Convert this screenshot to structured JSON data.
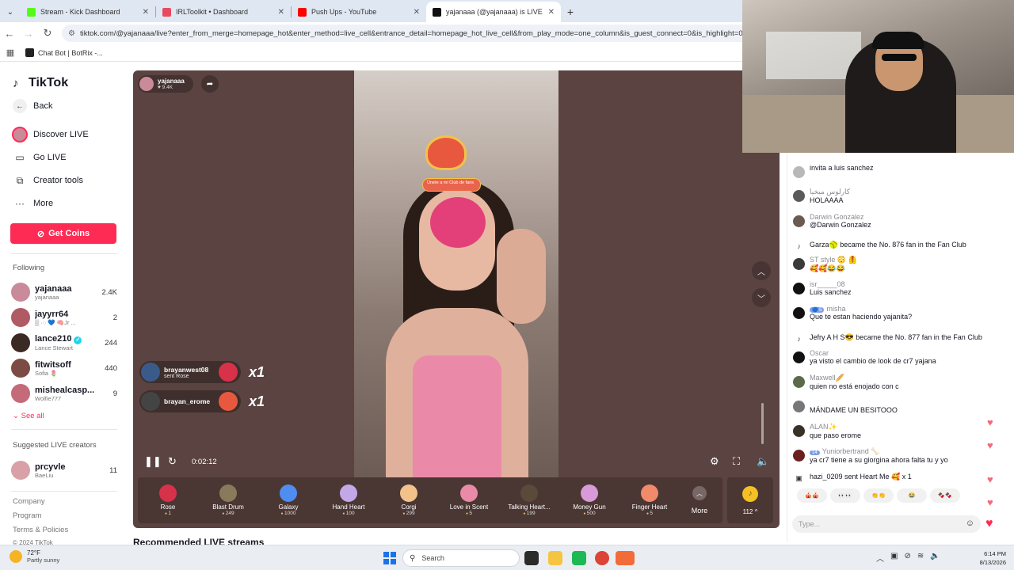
{
  "browser": {
    "tabs": [
      {
        "label": "Stream - Kick Dashboard",
        "favicon_color": "#53fc18",
        "active": false
      },
      {
        "label": "IRLToolkit • Dashboard",
        "favicon_color": "#e84a5f",
        "active": false
      },
      {
        "label": "Push Ups - YouTube",
        "favicon_color": "#ff0000",
        "active": false
      },
      {
        "label": "yajanaaa (@yajanaaa) is LIVE",
        "favicon_color": "#111111",
        "active": true
      }
    ],
    "url": "tiktok.com/@yajanaaa/live?enter_from_merge=homepage_hot&enter_method=live_cell&entrance_detail=homepage_hot_live_cell&from_play_mode=one_column&is_guest_connect=0&is_highlight=0&s",
    "bookmark": "Chat Bot | BotRix -..."
  },
  "sidebar": {
    "logo": "TikTok",
    "nav": [
      {
        "label": "Back",
        "icon": "back-arrow-icon"
      },
      {
        "label": "Discover LIVE",
        "icon": "live-avatar-icon"
      },
      {
        "label": "Go LIVE",
        "icon": "video-camera-icon"
      },
      {
        "label": "Creator tools",
        "icon": "creator-tools-icon"
      },
      {
        "label": "More",
        "icon": "more-dots-icon"
      }
    ],
    "get_coins": "Get Coins",
    "following_label": "Following",
    "following": [
      {
        "name": "yajanaaa",
        "sub": "yajanaaa",
        "count": "2.4K",
        "color": "#c98a9a",
        "verified": false
      },
      {
        "name": "jayyrr64",
        "sub": "▒ ·◌ 💙 🧠Jr ...",
        "count": "2",
        "color": "#b05a64",
        "verified": false
      },
      {
        "name": "lance210",
        "sub": "Lance Stewart",
        "count": "244",
        "color": "#3a2a26",
        "verified": true
      },
      {
        "name": "fitwitsoff",
        "sub": "Sofia 🌷",
        "count": "440",
        "color": "#7c4b44",
        "verified": false
      },
      {
        "name": "misheal​casp...",
        "sub": "Wolfie777",
        "count": "9",
        "color": "#c46a78",
        "verified": false
      }
    ],
    "see_all": "See all",
    "suggested_label": "Suggested LIVE creators",
    "suggested": [
      {
        "name": "prcyvle",
        "sub": "BaeLiu",
        "count": "11",
        "color": "#d9a0a8"
      }
    ],
    "footer": [
      "Company",
      "Program",
      "Terms & Policies",
      "© 2024 TikTok"
    ]
  },
  "player": {
    "host_name": "yajanaaa",
    "host_viewers": "9.4K",
    "filter_banner": "Únete a mi Club de fans",
    "gift_notifications": [
      {
        "user": "brayanwest08",
        "text": "sent Rose",
        "multiplier": "x1",
        "gift_color": "#d8314a"
      },
      {
        "user": "brayan_erome",
        "text": "",
        "multiplier": "x1",
        "gift_color": "#e8583e"
      }
    ],
    "elapsed": "0:02:12",
    "gifts": [
      {
        "name": "Rose",
        "price": "1",
        "color": "#d8314a"
      },
      {
        "name": "Blast Drum",
        "price": "249",
        "color": "#8a7a5c"
      },
      {
        "name": "Galaxy",
        "price": "1000",
        "color": "#4f8ef0"
      },
      {
        "name": "Hand Heart",
        "price": "100",
        "color": "#c3a8e8"
      },
      {
        "name": "Corgi",
        "price": "299",
        "color": "#f2c28a"
      },
      {
        "name": "Love in Scent",
        "price": "5",
        "color": "#e88aa8"
      },
      {
        "name": "Talking Heart...",
        "price": "199",
        "color": "#5a4a3a"
      },
      {
        "name": "Money Gun",
        "price": "500",
        "color": "#d89ad8"
      },
      {
        "name": "Finger Heart",
        "price": "5",
        "color": "#f08a6a"
      }
    ],
    "more_label": "More",
    "coins": "112 ^"
  },
  "recommended_heading": "Recommended LIVE streams",
  "chat": {
    "messages": [
      {
        "name": "",
        "text": "invita a luis sanchez",
        "color": "#b8b8b8"
      },
      {
        "name": "كارلوس ميخيا",
        "text": "HOLAAAA",
        "color": "#5a5a5a"
      },
      {
        "name": "Darwin Gonzalez",
        "text": "@Darwin Gonzalez",
        "color": "#6a5a52"
      },
      {
        "name": "",
        "text": "Garza🥎 became the No. 876 fan in the Fan Club",
        "color": "",
        "system": true
      },
      {
        "name": "ST style 😳 🦺",
        "text": "🥰🥰😂😂",
        "color": "#3a3a3a"
      },
      {
        "name": "isr_____08",
        "text": "Luis sanchez",
        "color": "#111111"
      },
      {
        "name": "misha",
        "text": "Que te estan haciendo yajanita?",
        "color": "#111111",
        "level": "🔵 5"
      },
      {
        "name": "",
        "text": "Jefry A H S😎 became the No. 877 fan in the Fan Club",
        "color": "",
        "system": true
      },
      {
        "name": "Oscar",
        "text": "ya visto el cambio de look de cr7 yajana",
        "color": "#111111"
      },
      {
        "name": "Maxwell🥖",
        "text": "quien no está enojado con c",
        "color": "#5a6a4a"
      },
      {
        "name": "",
        "text": "MÁNDAME UN BESITOOO",
        "color": "#777777"
      },
      {
        "name": "ALAN✨",
        "text": "que paso erome",
        "color": "#3a3026"
      },
      {
        "name": "Yuniorbertrand 🦴",
        "text": "ya cr7 tiene a su giorgina ahora falta tu y yo",
        "color": "#6a2020",
        "level": "14"
      },
      {
        "name": "",
        "text": "hazi_0209 sent Heart Me 🥰 x 1",
        "color": "",
        "system": true
      }
    ],
    "reactions": [
      "🎪🎪",
      "👀👀",
      "👏👏",
      "😂",
      "🍫🍫"
    ],
    "input_placeholder": "Type..."
  },
  "taskbar": {
    "weather_temp": "72°F",
    "weather_desc": "Partly sunny",
    "search_placeholder": "Search",
    "time": "6:14 PM",
    "date": "8/13/2026"
  }
}
